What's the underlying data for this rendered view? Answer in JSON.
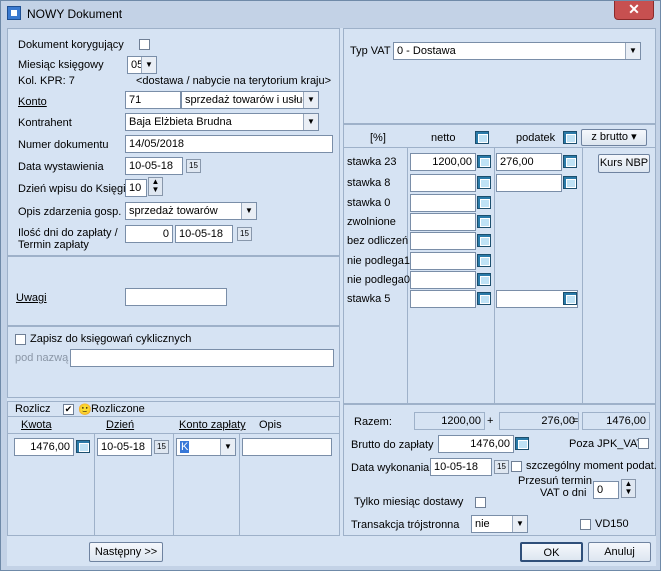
{
  "window": {
    "title": "NOWY Dokument",
    "close": "✕"
  },
  "left": {
    "korygujacy_label": "Dokument korygujący",
    "miesiac_label": "Miesiąc księgowy",
    "miesiac_value": "05",
    "kol_kpr": "Kol. KPR: 7",
    "kol_desc": "<dostawa / nabycie na terytorium kraju>",
    "konto_label": "Konto",
    "konto_value": "71",
    "konto_desc": "sprzedaż towarów i usług",
    "kontrahent_label": "Kontrahent",
    "kontrahent_value": "Baja Elżbieta Brudna",
    "numer_label": "Numer dokumentu",
    "numer_value": "14/05/2018",
    "data_wyst_label": "Data wystawienia",
    "data_wyst_value": "10-05-18",
    "dzien_wpisu_label": "Dzień wpisu do Księgi",
    "dzien_wpisu_value": "10",
    "opis_label": "Opis zdarzenia gosp.",
    "opis_value": "sprzedaż towarów",
    "ilosc_label1": "Ilość dni do zapłaty /",
    "ilosc_label2": "Termin zapłaty",
    "ilosc_value": "0",
    "termin_value": "10-05-18",
    "uwagi_label": "Uwagi",
    "uwagi_value": "",
    "zapisz_label": "Zapisz do księgowań cyklicznych",
    "pod_nazwa_label": "pod nazwą",
    "pod_nazwa_value": ""
  },
  "rozlicz": {
    "label": "Rozlicz",
    "checkbox": "✔",
    "rozliczone": "Rozliczone",
    "headers": [
      "Kwota",
      "Dzień",
      "Konto zapłaty",
      "Opis"
    ],
    "kwota": "1476,00",
    "dzien": "10-05-18",
    "konto": "K",
    "opis": ""
  },
  "right": {
    "typ_label": "Typ VAT",
    "typ_value": "0 - Dostawa",
    "col_pct": "[%]",
    "col_netto": "netto",
    "col_podatek": "podatek",
    "zbrutto": "z brutto",
    "kurs_nbp": "Kurs NBP",
    "rows": [
      {
        "label": "stawka 23",
        "netto": "1200,00",
        "podatek": "276,00"
      },
      {
        "label": "stawka 8",
        "netto": "",
        "podatek": ""
      },
      {
        "label": "stawka 0",
        "netto": ""
      },
      {
        "label": "zwolnione",
        "netto": ""
      },
      {
        "label": "bez odliczeń",
        "netto": ""
      },
      {
        "label": "nie podlega1",
        "netto": ""
      },
      {
        "label": "nie podlega0",
        "netto": ""
      },
      {
        "label": "stawka 5",
        "netto": "",
        "podatek": ""
      }
    ],
    "razem_label": "Razem:",
    "razem_netto": "1200,00",
    "plus": "+",
    "razem_podatek": "276,00",
    "eq": "=",
    "razem_brutto": "1476,00",
    "brutto_label": "Brutto do zapłaty",
    "brutto_value": "1476,00",
    "poza_jpk": "Poza JPK_VAT",
    "data_wyk_label": "Data wykonania",
    "data_wyk_value": "10-05-18",
    "szczegolny": "szczególny moment podat.",
    "przesun1": "Przesuń termin",
    "przesun2": "VAT o dni",
    "przesun_value": "0",
    "tylko_label": "Tylko miesiąc dostawy",
    "trans_label": "Transakcja trójstronna",
    "trans_value": "nie",
    "vd150": "VD150"
  },
  "buttons": {
    "nastepny": "Następny >>",
    "ok": "OK",
    "anuluj": "Anuluj"
  }
}
